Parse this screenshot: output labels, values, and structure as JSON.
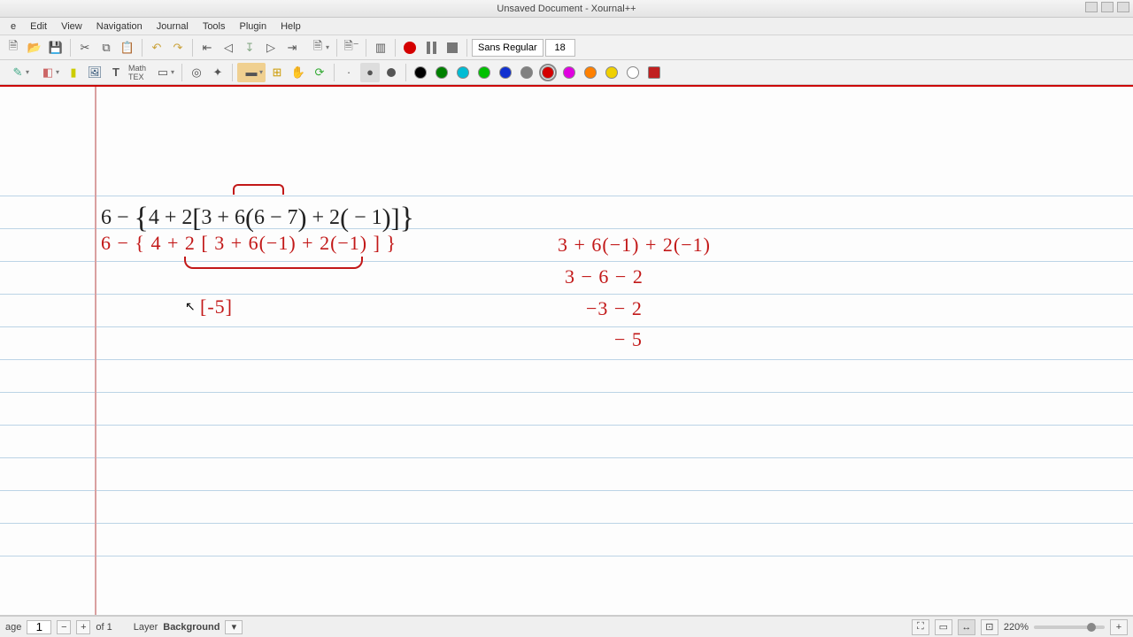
{
  "window": {
    "title": "Unsaved Document - Xournal++"
  },
  "menu": {
    "items": [
      "e",
      "Edit",
      "View",
      "Navigation",
      "Journal",
      "Tools",
      "Plugin",
      "Help"
    ]
  },
  "toolbar": {
    "font": "Sans Regular",
    "fontsize": "18"
  },
  "colors": {
    "palette": [
      "#000000",
      "#008000",
      "#00bcd4",
      "#00c000",
      "#1030d0",
      "#808080",
      "#d40000",
      "#e000e0",
      "#ff8000",
      "#f0d000",
      "#ffffff"
    ],
    "fill": "#c02020"
  },
  "canvas": {
    "typeset_expr": "6 − { 4 + 2 [ 3 + 6 ( 6 − 7 ) + 2 ( − 1 ) ] }",
    "hand_line1": "6 − { 4 + 2 [ 3 + 6(−1)   + 2(−1) ] }",
    "hand_box_left": "[-5]",
    "right_col": {
      "l1": "3 + 6(−1) + 2(−1)",
      "l2": "3  − 6  − 2",
      "l3": "−3  − 2",
      "l4": "− 5"
    }
  },
  "status": {
    "page_label": "age",
    "page_num": "1",
    "page_total": "of 1",
    "layer_label": "Layer",
    "layer_value": "Background",
    "zoom": "220%"
  }
}
